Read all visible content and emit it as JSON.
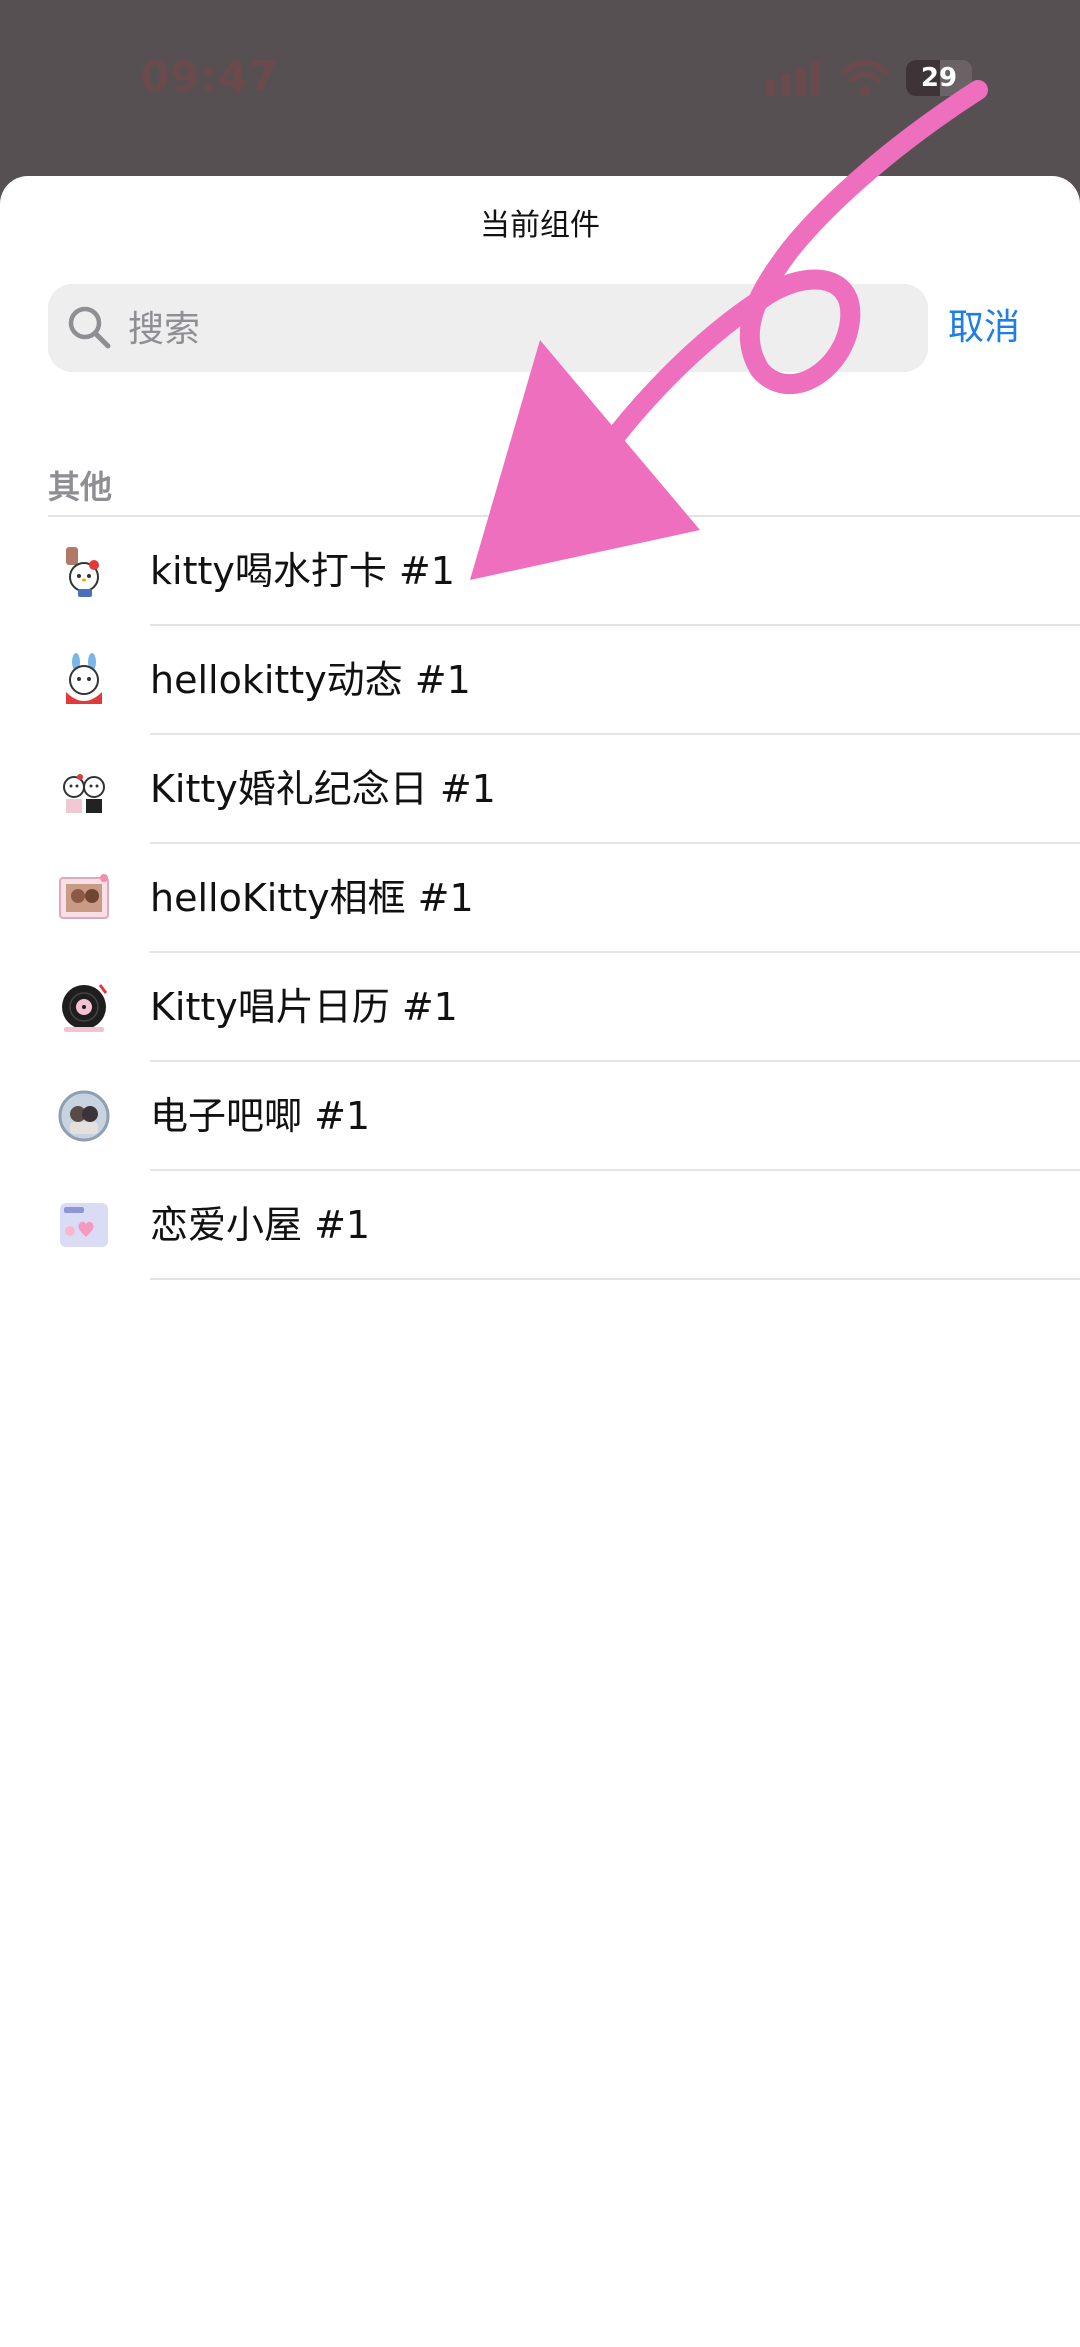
{
  "status_bar": {
    "time": "09:47",
    "battery": "29"
  },
  "sheet": {
    "title": "当前组件",
    "search": {
      "placeholder": "搜索",
      "value": ""
    },
    "cancel_label": "取消",
    "section_header": "其他",
    "items": [
      {
        "label": "kitty喝水打卡 #1",
        "icon": "hello-kitty-water-icon"
      },
      {
        "label": "hellokitty动态 #1",
        "icon": "hello-kitty-bunny-icon"
      },
      {
        "label": "Kitty婚礼纪念日 #1",
        "icon": "hello-kitty-wedding-icon"
      },
      {
        "label": "helloKitty相框 #1",
        "icon": "photo-frame-icon"
      },
      {
        "label": "Kitty唱片日历 #1",
        "icon": "vinyl-record-icon"
      },
      {
        "label": "电子吧唧 #1",
        "icon": "badge-photo-icon"
      },
      {
        "label": "恋爱小屋 #1",
        "icon": "love-house-icon"
      }
    ]
  },
  "colors": {
    "accent": "#1f7de6",
    "annotation": "#ee6fbd",
    "overlay": "#575052"
  }
}
